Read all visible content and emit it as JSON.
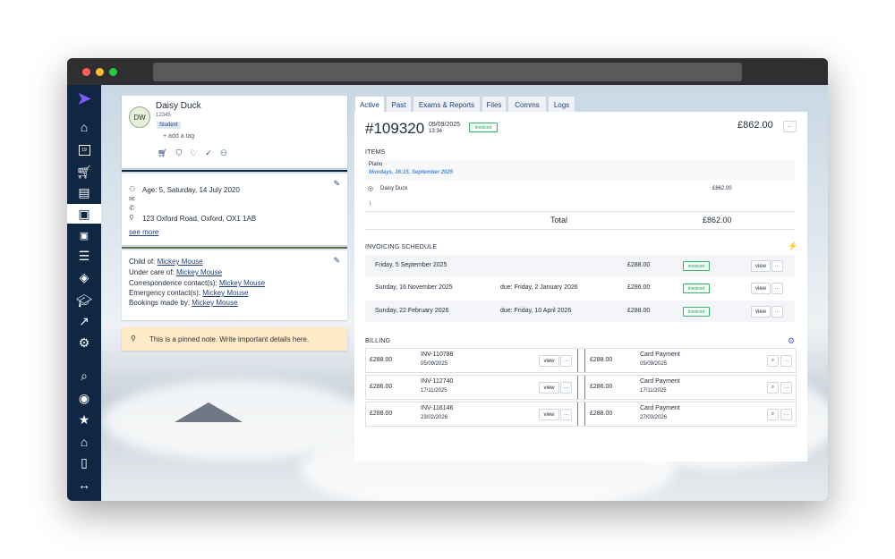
{
  "sidebar": {
    "icons": [
      "logo-icon",
      "home-icon",
      "calendar-icon",
      "cart-icon",
      "inbox-icon",
      "id-card-icon",
      "id-card-small-icon",
      "list-icon",
      "diamond-info-icon",
      "graduation-icon",
      "chart-icon",
      "gear-icon",
      "search-icon",
      "user-circle-icon",
      "star-icon",
      "house-icon",
      "door-icon",
      "arrows-icon"
    ],
    "calendar_day": "19"
  },
  "profile": {
    "initials": "DW",
    "name": "Daisy Duck",
    "id": "12345",
    "role_badge": "Student",
    "add_tag": "+ add a tag"
  },
  "details": {
    "age": "Age: 5, Saturday, 14 July 2020",
    "address": "123 Oxford Road, Oxford, OX1 1AB",
    "see_more": "see more"
  },
  "relations": {
    "child_of_label": "Child of:",
    "child_of": "Mickey Mouse",
    "under_care_label": "Under care of:",
    "under_care": "Mickey Mouse",
    "correspondence_label": "Correspondence contact(s):",
    "correspondence": "Mickey Mouse",
    "emergency_label": "Emergency contact(s):",
    "emergency": "Mickey Mouse",
    "bookings_label": "Bookings made by:",
    "bookings": "Mickey Mouse"
  },
  "pinned_note": "This is a pinned note. Write important details here.",
  "tabs": [
    "Active",
    "Past",
    "Exams & Reports",
    "Files",
    "Comms",
    "Logs"
  ],
  "invoice": {
    "number": "#109320",
    "date": "05/09/2025",
    "time": "13:34",
    "status": "invoiced",
    "total_header": "£862.00",
    "more": "···"
  },
  "items": {
    "title": "ITEMS",
    "item_name": "Piano",
    "item_schedule": "Mondays, 16:15, September 2025",
    "student": "Daisy Duck",
    "amount": "£862.00",
    "total_label": "Total",
    "total_value": "£862.00"
  },
  "schedule": {
    "title": "INVOICING SCHEDULE",
    "rows": [
      {
        "date": "Friday, 5 September 2025",
        "due": "",
        "amount": "£288.00",
        "status": "invoiced",
        "view": "view",
        "more": "···"
      },
      {
        "date": "Sunday, 16 November 2025",
        "due": "due: Friday, 2 January 2026",
        "amount": "£286.00",
        "status": "invoiced",
        "view": "view",
        "more": "···"
      },
      {
        "date": "Sunday, 22 February 2026",
        "due": "due: Friday, 10 April 2026",
        "amount": "£288.00",
        "status": "invoiced",
        "view": "view",
        "more": "···"
      }
    ]
  },
  "billing": {
    "title": "BILLING",
    "rows": [
      {
        "amount": "£288.00",
        "inv": "INV-110788",
        "inv_date": "05/09/2025",
        "view": "view",
        "more": "···",
        "pay_amount": "£288.00",
        "pay_type": "Card Payment",
        "pay_date": "05/09/2025"
      },
      {
        "amount": "£286.00",
        "inv": "INV-112740",
        "inv_date": "17/11/2025",
        "view": "view",
        "more": "···",
        "pay_amount": "£286.00",
        "pay_type": "Card Payment",
        "pay_date": "17/11/2025"
      },
      {
        "amount": "£288.00",
        "inv": "INV-116146",
        "inv_date": "23/02/2026",
        "view": "view",
        "more": "···",
        "pay_amount": "£288.00",
        "pay_type": "Card Payment",
        "pay_date": "27/03/2026"
      }
    ]
  },
  "colors": {
    "sidebar": "#0f2743",
    "accent_green": "#2fae5f",
    "link_blue": "#1f3f7a",
    "schedule_italic": "#4a8ad8",
    "note_bg": "#fdebc8",
    "lightning": "#f5b800"
  }
}
